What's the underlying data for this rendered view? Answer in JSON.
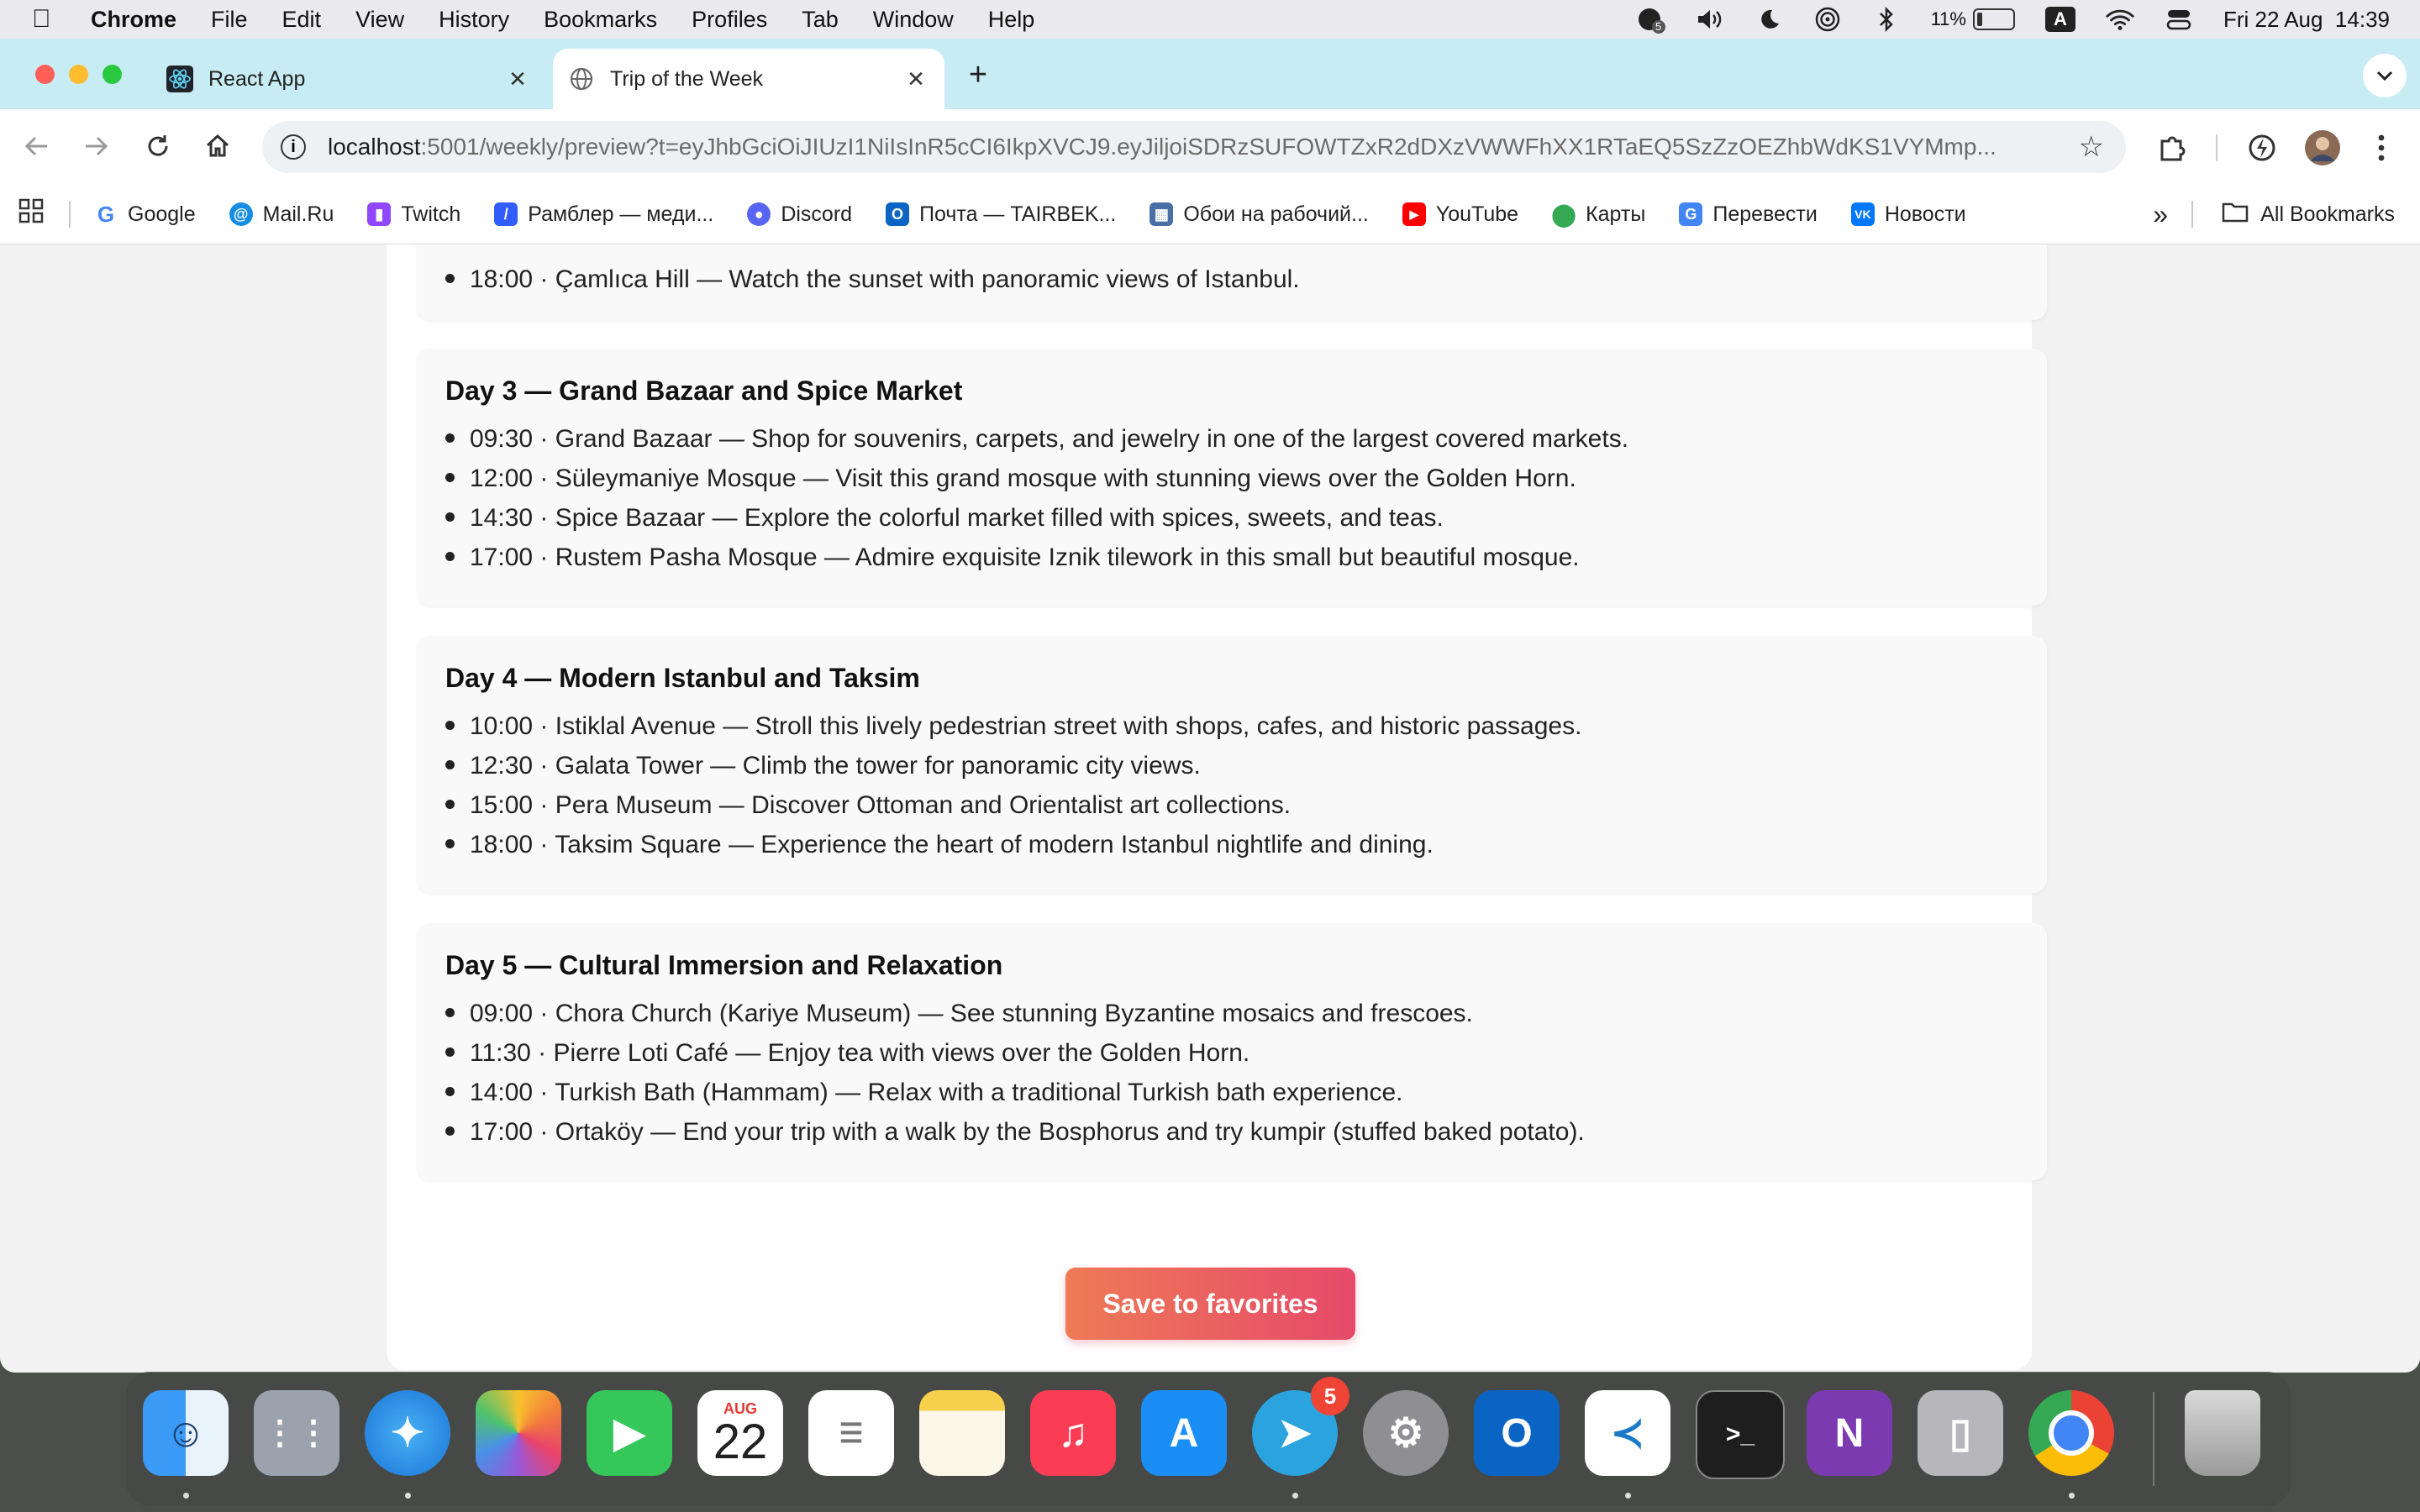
{
  "menubar": {
    "app": "Chrome",
    "items": [
      "File",
      "Edit",
      "View",
      "History",
      "Bookmarks",
      "Profiles",
      "Tab",
      "Window",
      "Help"
    ],
    "battery": "11%",
    "input_source": "A",
    "datetime": "Fri 22 Aug  14:39",
    "status_badge": "5"
  },
  "browser": {
    "tabs": [
      {
        "title": "React App",
        "active": false
      },
      {
        "title": "Trip of the Week",
        "active": true
      }
    ],
    "url_host": "localhost",
    "url_path": ":5001/weekly/preview?t=eyJhbGciOiJIUzI1NiIsInR5cCI6IkpXVCJ9.eyJiljoiSDRzSUFOWTZxR2dDXzVWWFhXX1RTaEQ5SzZzOEZhbWdKS1VYMmp..."
  },
  "bookmarks": [
    {
      "label": "Google",
      "icon": "google-icon",
      "color": "#4285f4"
    },
    {
      "label": "Mail.Ru",
      "icon": "mailru-icon",
      "color": "#168de2"
    },
    {
      "label": "Twitch",
      "icon": "twitch-icon",
      "color": "#9146ff"
    },
    {
      "label": "Рамблер — меди...",
      "icon": "rambler-icon",
      "color": "#315efb"
    },
    {
      "label": "Discord",
      "icon": "discord-icon",
      "color": "#5865f2"
    },
    {
      "label": "Почта — TAIRBEK...",
      "icon": "outlook-icon",
      "color": "#0a64c4"
    },
    {
      "label": "Обои на рабочий...",
      "icon": "wallpaper-icon",
      "color": "#4a6fa5"
    },
    {
      "label": "YouTube",
      "icon": "youtube-icon",
      "color": "#ff0000"
    },
    {
      "label": "Карты",
      "icon": "maps-icon",
      "color": "#34a853"
    },
    {
      "label": "Перевести",
      "icon": "translate-icon",
      "color": "#4285f4"
    },
    {
      "label": "Новости",
      "icon": "vk-icon",
      "color": "#0077ff"
    }
  ],
  "bookmarks_all": "All Bookmarks",
  "trip": {
    "day2_last": "18:00 · Çamlıca Hill — Watch the sunset with panoramic views of Istanbul.",
    "days": [
      {
        "title": "Day 3 — Grand Bazaar and Spice Market",
        "items": [
          "09:30 · Grand Bazaar — Shop for souvenirs, carpets, and jewelry in one of the largest covered markets.",
          "12:00 · Süleymaniye Mosque — Visit this grand mosque with stunning views over the Golden Horn.",
          "14:30 · Spice Bazaar — Explore the colorful market filled with spices, sweets, and teas.",
          "17:00 · Rustem Pasha Mosque — Admire exquisite Iznik tilework in this small but beautiful mosque."
        ]
      },
      {
        "title": "Day 4 — Modern Istanbul and Taksim",
        "items": [
          "10:00 · Istiklal Avenue — Stroll this lively pedestrian street with shops, cafes, and historic passages.",
          "12:30 · Galata Tower — Climb the tower for panoramic city views.",
          "15:00 · Pera Museum — Discover Ottoman and Orientalist art collections.",
          "18:00 · Taksim Square — Experience the heart of modern Istanbul nightlife and dining."
        ]
      },
      {
        "title": "Day 5 — Cultural Immersion and Relaxation",
        "items": [
          "09:00 · Chora Church (Kariye Museum) — See stunning Byzantine mosaics and frescoes.",
          "11:30 · Pierre Loti Café — Enjoy tea with views over the Golden Horn.",
          "14:00 · Turkish Bath (Hammam) — Relax with a traditional Turkish bath experience.",
          "17:00 · Ortaköy — End your trip with a walk by the Bosphorus and try kumpir (stuffed baked potato)."
        ]
      }
    ],
    "save_button": "Save to favorites"
  },
  "dock": {
    "calendar_month": "AUG",
    "calendar_day": "22",
    "telegram_badge": "5",
    "apps": [
      "finder-icon",
      "launchpad-icon",
      "safari-icon",
      "photos-icon",
      "facetime-icon",
      "calendar-icon",
      "reminders-icon",
      "notes-icon",
      "music-icon",
      "appstore-icon",
      "telegram-icon",
      "settings-icon",
      "outlook-icon",
      "vscode-icon",
      "terminal-icon",
      "onenote-icon",
      "iphone-mirroring-icon",
      "chrome-icon",
      "trash-icon"
    ]
  }
}
